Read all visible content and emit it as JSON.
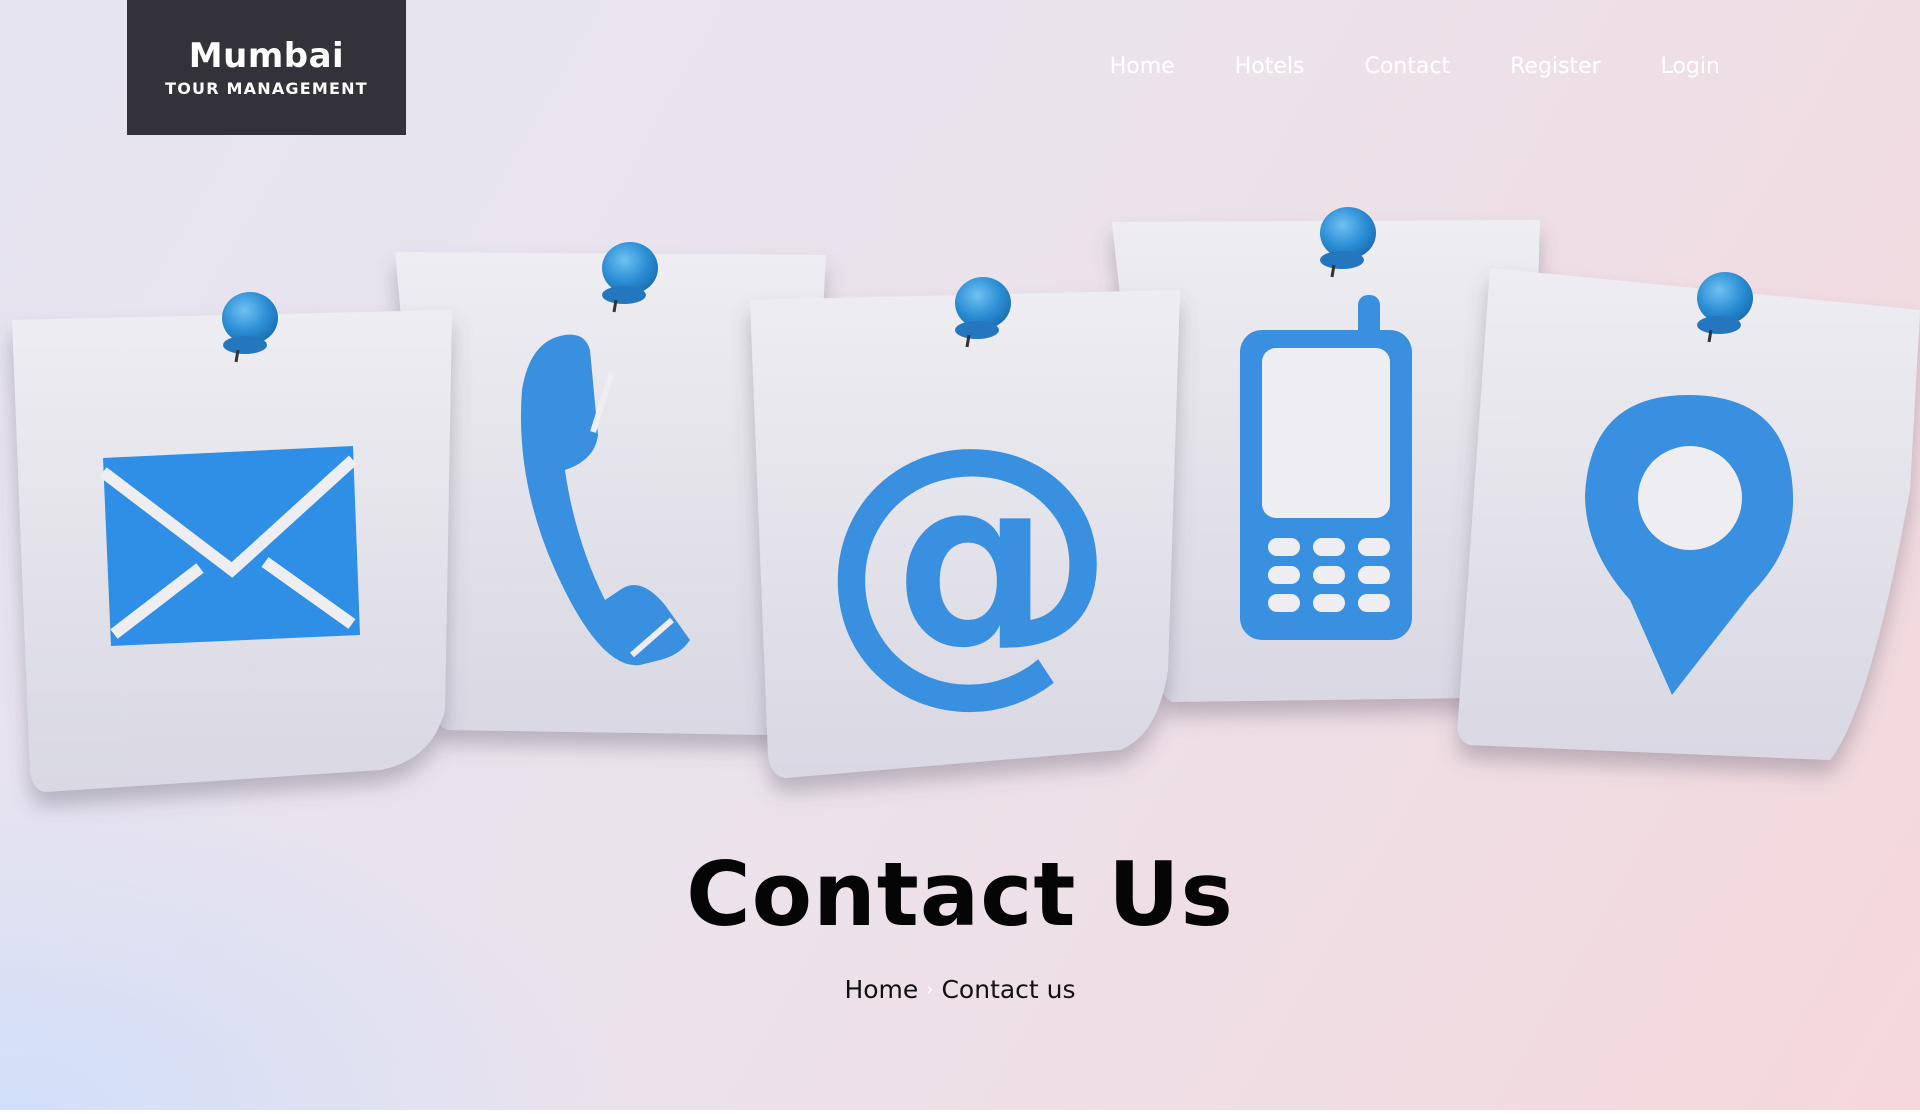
{
  "brand": {
    "name": "Mumbai",
    "tagline": "TOUR MANAGEMENT"
  },
  "nav": {
    "items": [
      {
        "label": "Home"
      },
      {
        "label": "Hotels"
      },
      {
        "label": "Contact"
      },
      {
        "label": "Register"
      },
      {
        "label": "Login"
      }
    ]
  },
  "hero": {
    "cards": [
      "envelope-icon",
      "telephone-icon",
      "at-sign-icon",
      "mobile-phone-icon",
      "location-pin-icon"
    ],
    "accent": "#3a90e0",
    "pin_color": "#2b8fd6"
  },
  "page": {
    "title": "Contact Us",
    "breadcrumb": {
      "home": "Home",
      "separator": "›",
      "current": "Contact us"
    }
  }
}
